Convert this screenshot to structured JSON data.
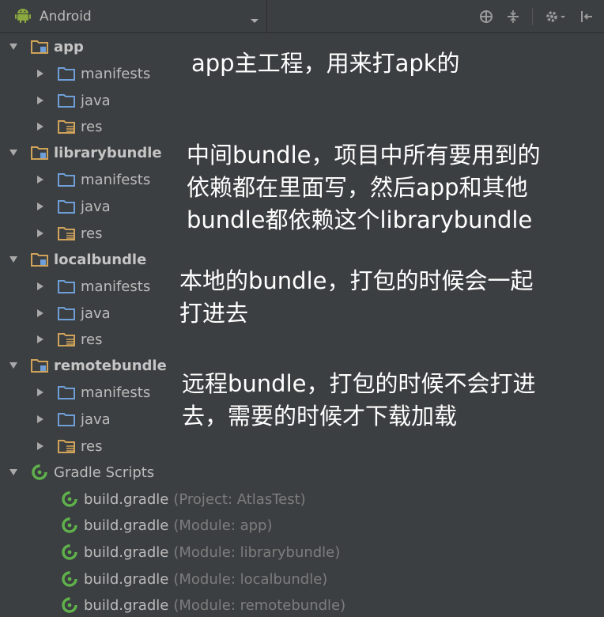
{
  "header": {
    "view_label": "Android",
    "icons": [
      "android-icon",
      "dropdown-arrow-icon",
      "target-icon",
      "collapse-icon",
      "gear-icon",
      "hide-panel-icon"
    ]
  },
  "tree": {
    "modules": [
      {
        "name": "app",
        "children": [
          "manifests",
          "java",
          "res"
        ]
      },
      {
        "name": "librarybundle",
        "children": [
          "manifests",
          "java",
          "res"
        ]
      },
      {
        "name": "localbundle",
        "children": [
          "manifests",
          "java",
          "res"
        ]
      },
      {
        "name": "remotebundle",
        "children": [
          "manifests",
          "java",
          "res"
        ]
      }
    ],
    "gradle": {
      "label": "Gradle Scripts",
      "files": [
        {
          "name": "build.gradle",
          "detail": "(Project: AtlasTest)"
        },
        {
          "name": "build.gradle",
          "detail": "(Module: app)"
        },
        {
          "name": "build.gradle",
          "detail": "(Module: librarybundle)"
        },
        {
          "name": "build.gradle",
          "detail": "(Module: localbundle)"
        },
        {
          "name": "build.gradle",
          "detail": "(Module: remotebundle)"
        }
      ]
    }
  },
  "annotations": {
    "app": [
      "app主工程，用来打apk的"
    ],
    "librarybundle": [
      "中间bundle，项目中所有要用到的",
      "依赖都在里面写，然后app和其他",
      "bundle都依赖这个librarybundle"
    ],
    "localbundle": [
      "本地的bundle，打包的时候会一起",
      "打进去"
    ],
    "remotebundle": [
      "远程bundle，打包的时候不会打进",
      "去，需要的时候才下载加载"
    ]
  },
  "colors": {
    "background": "#3c3f41",
    "text": "#bbbbbb",
    "folder_blue": "#6f9fd8",
    "module_orange": "#d0a35a",
    "gradle_green": "#5fb24b",
    "annotation": "#ffffff"
  }
}
